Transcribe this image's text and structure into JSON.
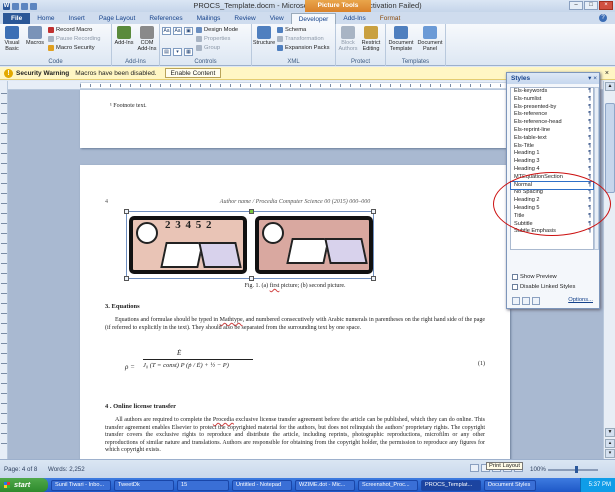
{
  "window": {
    "title": "PROCS_Template.docm - Microsoft Word (Product Activation Failed)",
    "context_tab": "Picture Tools"
  },
  "tabs": [
    "File",
    "Home",
    "Insert",
    "Page Layout",
    "References",
    "Mailings",
    "Review",
    "View",
    "Developer",
    "Add-Ins",
    "Format"
  ],
  "ribbon": {
    "code": {
      "label": "Code",
      "visual_basic": "Visual Basic",
      "macros": "Macros",
      "record_macro": "Record Macro",
      "pause_recording": "Pause Recording",
      "macro_security": "Macro Security"
    },
    "addins": {
      "label": "Add-Ins",
      "add_ins": "Add-Ins",
      "com_addins": "COM Add-Ins"
    },
    "controls": {
      "label": "Controls",
      "design_mode": "Design Mode",
      "properties": "Properties",
      "group": "Group"
    },
    "xml": {
      "label": "XML",
      "structure": "Structure",
      "schema": "Schema",
      "transformation": "Transformation",
      "expansion_packs": "Expansion Packs"
    },
    "protect": {
      "label": "Protect",
      "block_authors": "Block Authors",
      "restrict_editing": "Restrict Editing"
    },
    "templates": {
      "label": "Templates",
      "document_template": "Document Template",
      "document_panel": "Document Panel"
    }
  },
  "security_bar": {
    "title": "Security Warning",
    "message": "Macros have been disabled.",
    "button": "Enable Content"
  },
  "document": {
    "footnote": "¹ Footnote text.",
    "page_number": "4",
    "header": "Author name / Procedia Computer Science 00 (2015) 000–000",
    "caption_prefix": "Fig. 1. (a) ",
    "caption_first": "first",
    "caption_suffix": " picture; (b) second picture.",
    "fig_digits": "2 3 4 5 2",
    "section3_title": "3. Equations",
    "section3_p1a": "Equations and formulae should be typed in ",
    "section3_mathtype": "Mathtype",
    "section3_p1b": ", and numbered consecutively with Arabic numerals in parentheses on the right hand side of the page (if referred to explicitly in the text). They should also be separated from the surrounding text by one space.",
    "eq_lhs": "ρ =",
    "eq_num_top": "Ė",
    "eq_body": "J₀ (T = const)  P (ṗ / Ė) + ½ − P)",
    "eq_label": "(1)",
    "section4_title": "4 . Online license transfer",
    "section4_pa": "All authors are required to complete the ",
    "section4_procedia": "Procedia",
    "section4_pb": " exclusive license transfer agreement before the article can be published, which they can do online. This transfer agreement enables Elsevier to protect the copyrighted material for the authors, but does not relinquish the authors' proprietary rights. The copyright transfer covers the exclusive rights to reproduce and distribute the article, including reprints, photographic reproductions, microfilm or any other reproductions of similar nature and translations. Authors are responsible for obtaining from the copyright holder, the permission to reproduce any figures for which copyright exists."
  },
  "styles_pane": {
    "title": "Styles",
    "items": [
      "Els-keywords",
      "Els-numlist",
      "Els-presented-by",
      "Els-reference",
      "Els-reference-head",
      "Els-reprint-line",
      "Els-table-text",
      "Els-Title",
      "Heading 1",
      "Heading 3",
      "Heading 4",
      "MTEquationSection",
      "Normal",
      "No Spacing",
      "Heading 2",
      "Heading 5",
      "Title",
      "Subtitle",
      "Subtle Emphasis"
    ],
    "selected_index": 12,
    "show_preview": "Show Preview",
    "disable_linked": "Disable Linked Styles",
    "options": "Options..."
  },
  "status_bar": {
    "page": "Page: 4 of 8",
    "words": "Words: 2,252",
    "tooltip": "Print Layout",
    "zoom": "100%"
  },
  "taskbar": {
    "start": "start",
    "items": [
      "Sunil Tiwari - Inbo...",
      "TweetDk",
      "15",
      "Untitled - Notepad",
      "WZIME.dot - Mic...",
      "Screenshot_Proc...",
      "PROCS_Templat...",
      "Document Styles"
    ],
    "clock": "5:37 PM"
  }
}
